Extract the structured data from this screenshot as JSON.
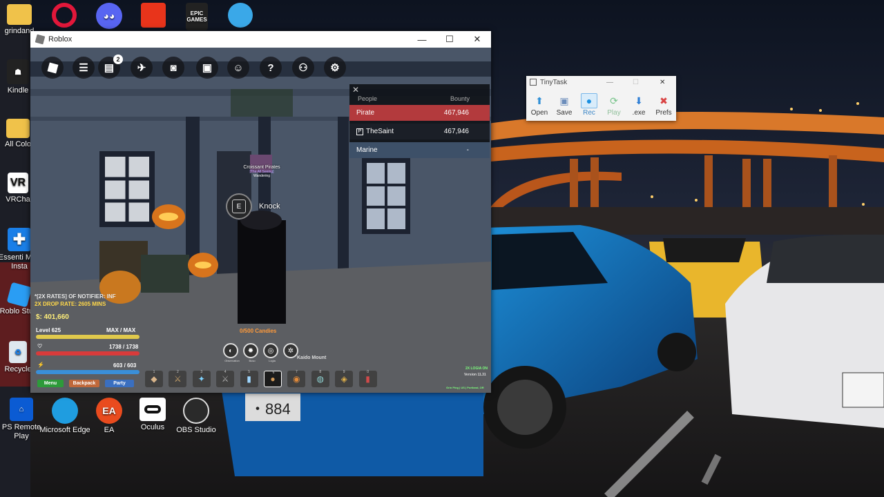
{
  "desktop": {
    "icons": [
      {
        "label": "grindand",
        "icon": "folder-icon"
      },
      {
        "label": "",
        "icon": "opera-icon"
      },
      {
        "label": "",
        "icon": "discord-icon"
      },
      {
        "label": "",
        "icon": "game-icon"
      },
      {
        "label": "EPIC GAMES",
        "icon": "epic-games-icon"
      },
      {
        "label": "",
        "icon": "globe-icon"
      },
      {
        "label": "Kindle",
        "icon": "kindle-icon"
      },
      {
        "label": "All Colo",
        "icon": "folder-icon"
      },
      {
        "label": "VRCha",
        "icon": "vrchat-icon"
      },
      {
        "label": "Essenti Mod Insta",
        "icon": "essential-mod-icon"
      },
      {
        "label": "Roblo Studi",
        "icon": "roblox-studio-icon"
      },
      {
        "label": "Recycle",
        "icon": "recycle-bin-icon"
      },
      {
        "label": "PS Remote Play",
        "icon": "ps-remote-play-icon"
      },
      {
        "label": "Microsoft Edge",
        "icon": "edge-icon"
      },
      {
        "label": "EA",
        "icon": "ea-icon"
      },
      {
        "label": "Oculus",
        "icon": "oculus-icon"
      },
      {
        "label": "OBS Studio",
        "icon": "obs-icon"
      }
    ]
  },
  "roblox_window": {
    "title": "Roblox",
    "controls": {
      "minimize": "—",
      "maximize": "☐",
      "close": "✕"
    },
    "topbar": {
      "notification_count": "2",
      "help": "?"
    },
    "overhead": {
      "crew": "Croissant Pirates",
      "subtitle": "[The All Seeing]",
      "title_small": "Wandering"
    },
    "prompt": {
      "key": "E",
      "action": "Knock"
    },
    "bounty": {
      "close": "✕",
      "headers": [
        "People",
        "Bounty"
      ],
      "rows": [
        {
          "name": "Pirate",
          "value": "467,946",
          "color": "#b33a3d"
        },
        {
          "name": "TheSaint",
          "value": "467,946",
          "color": "#1b1f27"
        },
        {
          "name": "Marine",
          "value": "-",
          "color": "#3d5068"
        }
      ]
    },
    "hud": {
      "notice_1": "*[2X RATES] OF NOTIFIER: INF",
      "notice_2": "2X DROP RATE: 2605 MINS",
      "money": "$: 401,660",
      "level": "Level 625",
      "max": "MAX / MAX",
      "health": "1738 / 1738",
      "energy": "603 / 603",
      "candies": "0/500 Candies",
      "mount_label": "Kaido Mount",
      "ability_labels": [
        "Observation",
        "Buso",
        "Logia",
        ""
      ],
      "menu": "Menu",
      "backpack": "Backpack",
      "party": "Party",
      "server_info_1": "2X LOGIA ON",
      "server_info_2": "Version 11.31",
      "server_info_3": "Grin Ping | US | Portland, OR",
      "level_progress": 1.0,
      "health_progress": 1.0,
      "energy_progress": 1.0
    },
    "hotbar": [
      {
        "num": "1",
        "glyph": "◆"
      },
      {
        "num": "2",
        "glyph": "⚔"
      },
      {
        "num": "3",
        "glyph": "✦"
      },
      {
        "num": "4",
        "glyph": "⚔"
      },
      {
        "num": "5",
        "glyph": "▮"
      },
      {
        "num": "6",
        "glyph": "●"
      },
      {
        "num": "7",
        "glyph": "◉"
      },
      {
        "num": "8",
        "glyph": "◍"
      },
      {
        "num": "9",
        "glyph": "◈"
      },
      {
        "num": "0",
        "glyph": "▮"
      }
    ]
  },
  "tinytask": {
    "title": "TinyTask",
    "buttons": [
      {
        "label": "Open",
        "icon": "open-icon"
      },
      {
        "label": "Save",
        "icon": "save-icon"
      },
      {
        "label": "Rec",
        "icon": "record-icon"
      },
      {
        "label": "Play",
        "icon": "play-icon"
      },
      {
        "label": ".exe",
        "icon": "exe-download-icon"
      },
      {
        "label": "Prefs",
        "icon": "prefs-icon"
      }
    ]
  }
}
